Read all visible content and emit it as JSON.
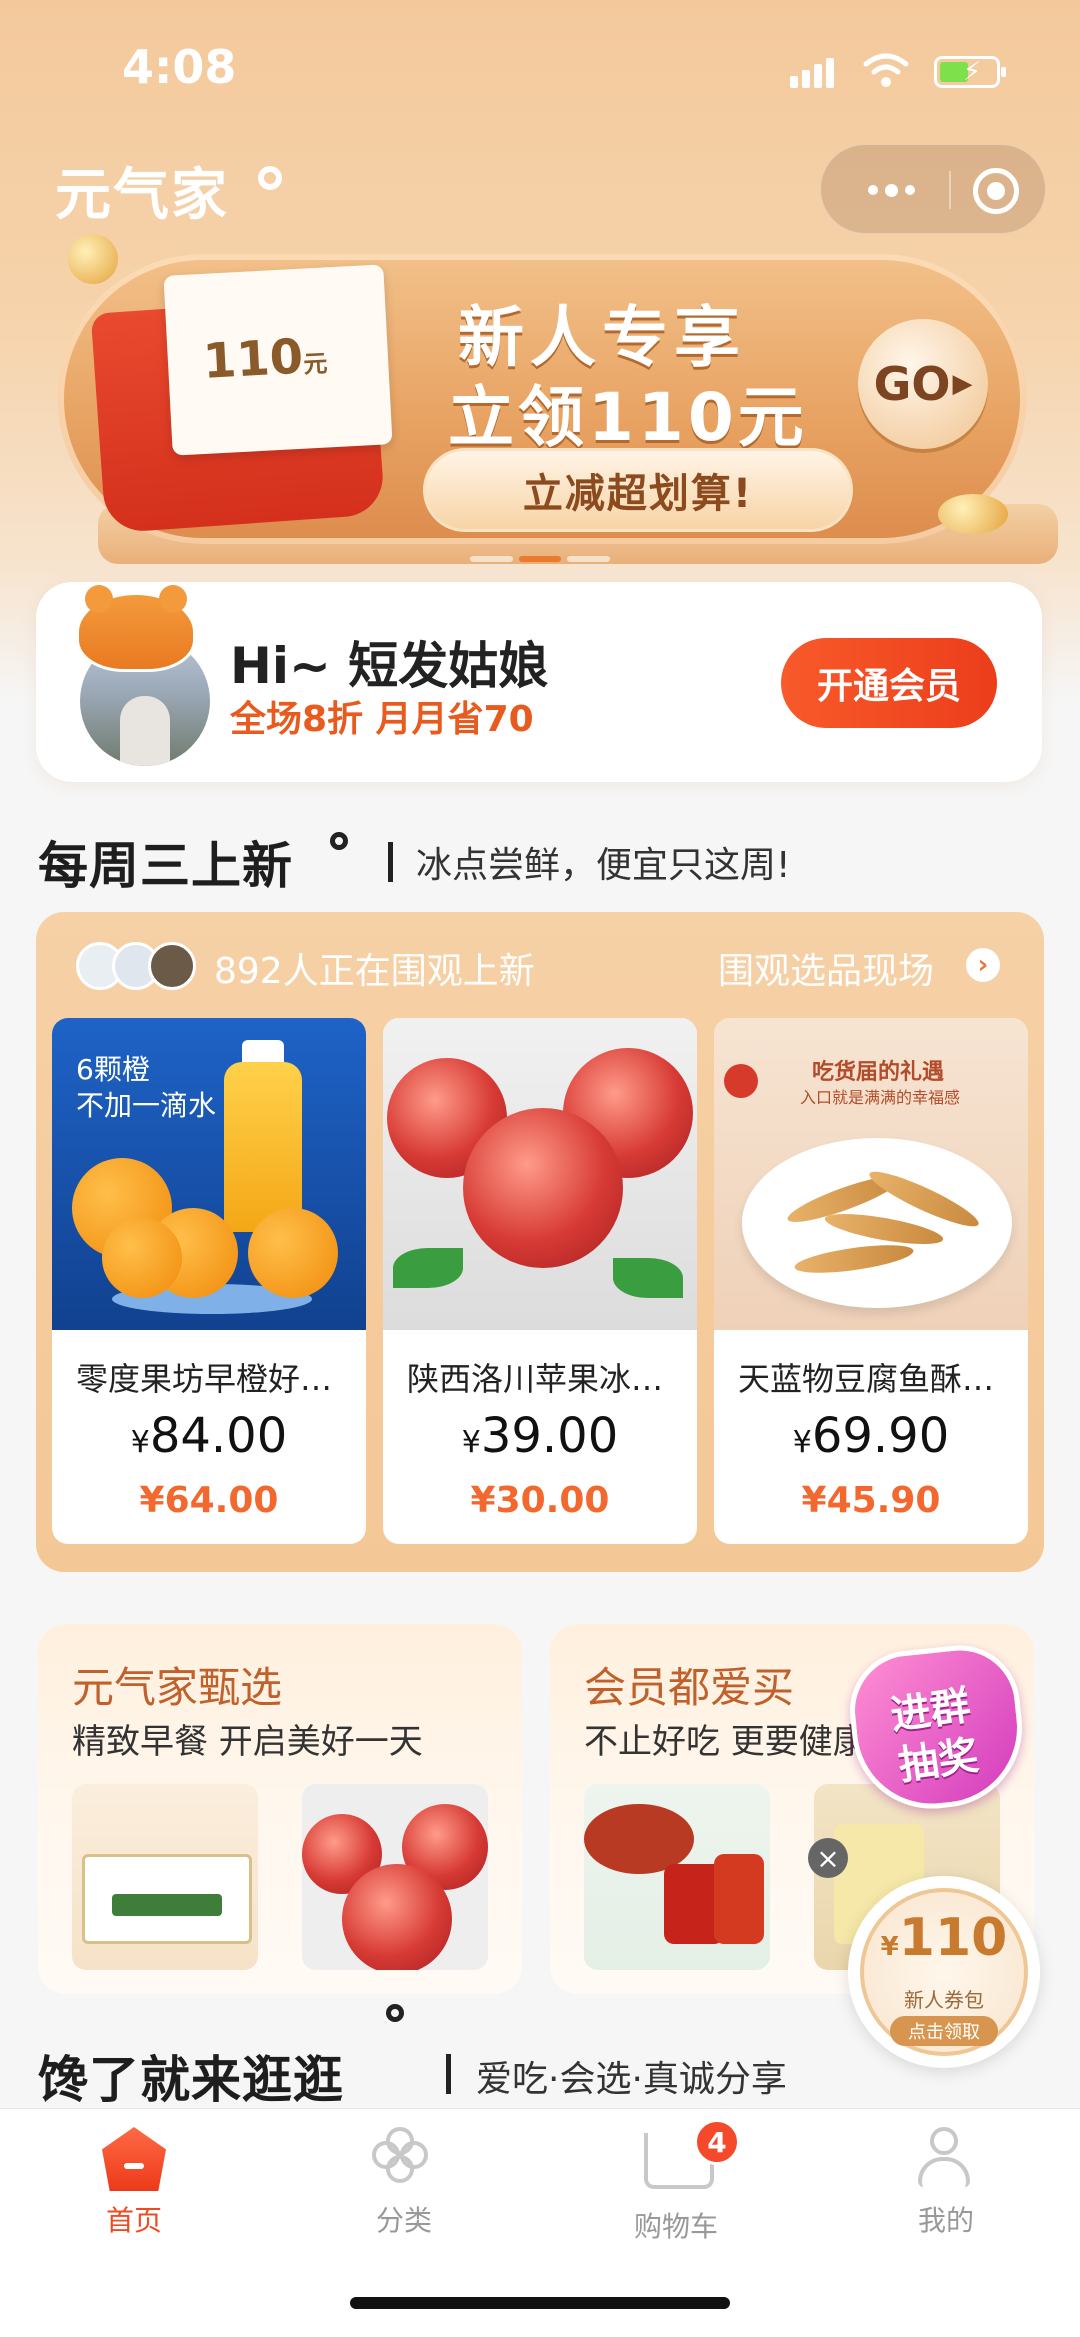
{
  "status_bar": {
    "time": "4:08"
  },
  "header": {
    "app_title": "元气家"
  },
  "banner": {
    "card_amount": "110",
    "card_unit": "元",
    "line1": "新人专享",
    "line2": "立领110元",
    "pill": "立减超划算!",
    "go": "GO"
  },
  "member": {
    "greeting": "Hi~ 短发姑娘",
    "perk": "全场8折  月月省70",
    "button": "开通会员"
  },
  "weekly": {
    "title": "每周三上新",
    "subtitle": "冰点尝鲜，便宜只这周!",
    "watchers": "892人正在围观上新",
    "link": "围观选品现场",
    "products": [
      {
        "name": "零度果坊早橙好…",
        "original_price": "84.00",
        "sale_price": "¥64.00",
        "img_text1": "6颗橙",
        "img_text2": "不加一滴水"
      },
      {
        "name": "陕西洛川苹果冰…",
        "original_price": "39.00",
        "sale_price": "¥30.00"
      },
      {
        "name": "天蓝物豆腐鱼酥…",
        "original_price": "69.90",
        "sale_price": "¥45.90",
        "img_text1": "吃货届的礼遇",
        "img_text2": "入口就是满满的幸福感"
      }
    ]
  },
  "cards": [
    {
      "title": "元气家甄选",
      "subtitle": "精致早餐 开启美好一天"
    },
    {
      "title": "会员都爱买",
      "subtitle": "不止好吃  更要健康"
    }
  ],
  "lottery": {
    "line1": "进群",
    "line2": "抽奖"
  },
  "coupon": {
    "amount": "110",
    "label": "新人券包",
    "claim": "点击领取"
  },
  "browse": {
    "title": "馋了就来逛逛",
    "subtitle": "爱吃·会选·真诚分享"
  },
  "tabs": [
    {
      "label": "首页"
    },
    {
      "label": "分类"
    },
    {
      "label": "购物车",
      "badge": "4"
    },
    {
      "label": "我的"
    }
  ],
  "colors": {
    "accent": "#ef4b22",
    "price_sale": "#f2682f",
    "panel": "#f6d1a6"
  }
}
